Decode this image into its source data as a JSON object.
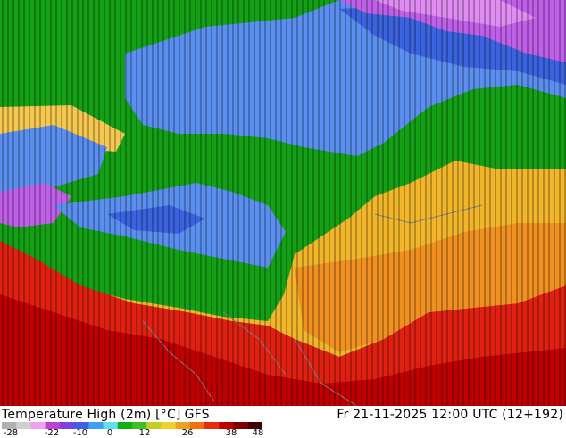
{
  "map": {
    "boundary_color": "#808080",
    "regions": [
      {
        "name": "cold-north",
        "color": "#5a8ff0"
      },
      {
        "name": "very-cold",
        "color": "#3b63e0"
      },
      {
        "name": "freezing",
        "color": "#c060e8"
      },
      {
        "name": "mild",
        "color": "#12a412"
      },
      {
        "name": "warm",
        "color": "#f0b030"
      },
      {
        "name": "hot",
        "color": "#e02010"
      }
    ]
  },
  "footer": {
    "title": "Temperature High (2m) [°C]",
    "model": "GFS",
    "datetime": "Fr 21-11-2025 12:00 UTC (12+192)"
  },
  "colorbar": {
    "ticks": [
      "-28",
      "-22",
      "-10",
      "0",
      "12",
      "26",
      "38",
      "48"
    ],
    "stops": [
      "#b0b0b0",
      "#d0d0d0",
      "#f0a0f0",
      "#c040d0",
      "#8040e0",
      "#4060e8",
      "#40a0f0",
      "#60e0f0",
      "#10b010",
      "#40c020",
      "#c0d020",
      "#f0d030",
      "#f0a020",
      "#f07010",
      "#e03010",
      "#c00000",
      "#800000",
      "#400000"
    ]
  }
}
